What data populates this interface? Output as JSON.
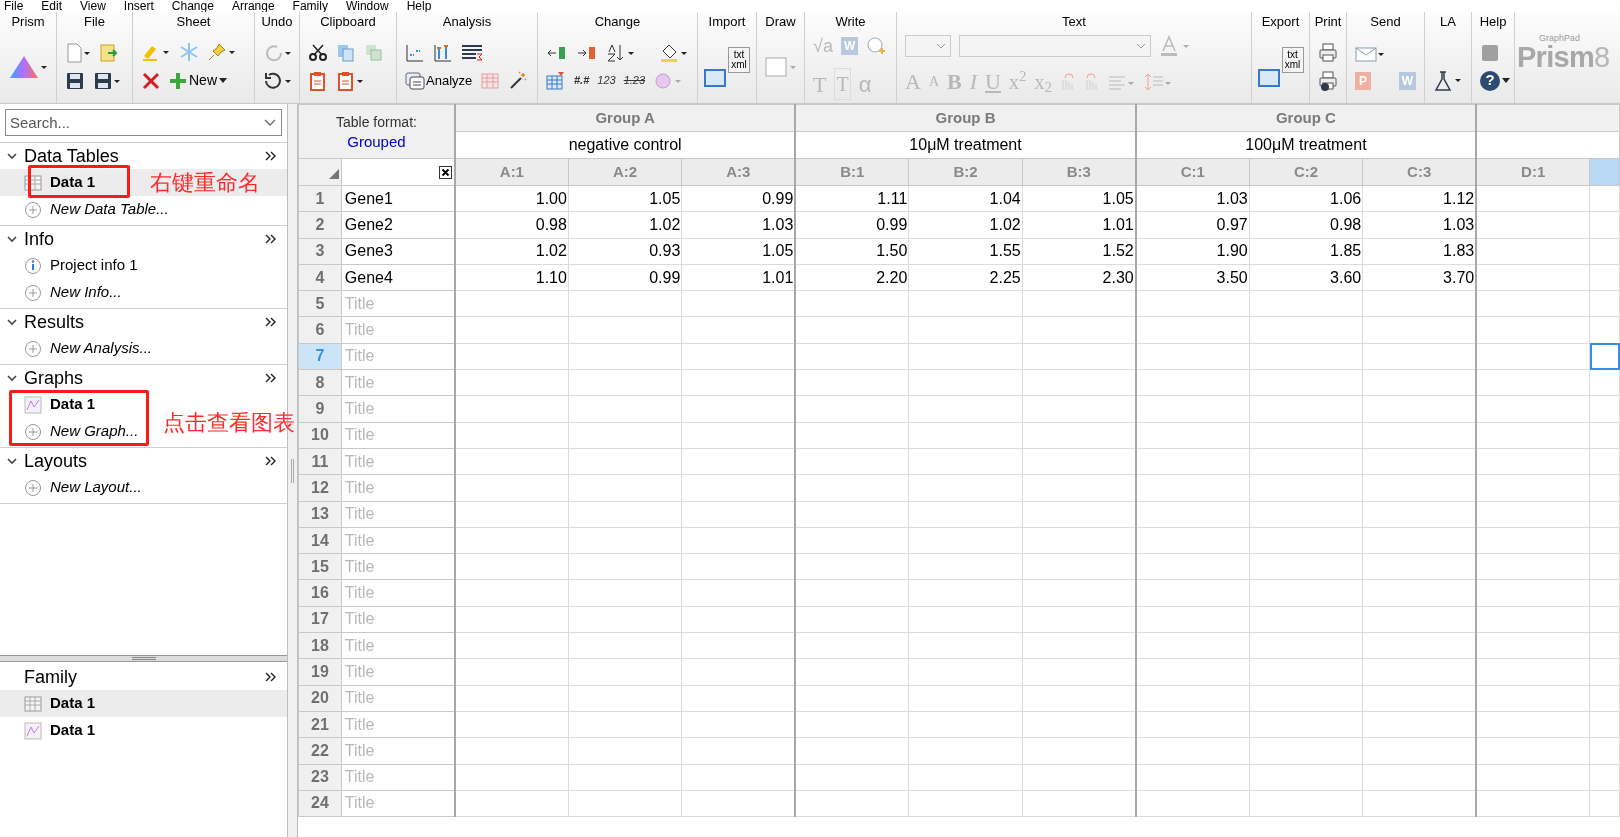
{
  "menu": [
    "File",
    "Edit",
    "View",
    "Insert",
    "Change",
    "Arrange",
    "Family",
    "Window",
    "Help"
  ],
  "toolbar": [
    {
      "kind": "prism",
      "label": "Prism"
    },
    {
      "kind": "file",
      "label": "File"
    },
    {
      "kind": "sheet",
      "label": "Sheet",
      "button": "New"
    },
    {
      "kind": "undo",
      "label": "Undo"
    },
    {
      "kind": "clipboard",
      "label": "Clipboard"
    },
    {
      "kind": "analysis",
      "label": "Analysis",
      "button": "Analyze"
    },
    {
      "kind": "change",
      "label": "Change",
      "glyphs": [
        "#.#",
        "123",
        "1.23"
      ]
    },
    {
      "kind": "import",
      "label": "Import",
      "glyphs": [
        "txt",
        "xml"
      ]
    },
    {
      "kind": "draw",
      "label": "Draw"
    },
    {
      "kind": "write",
      "label": "Write",
      "glyphs": [
        "√a",
        "W",
        "T",
        "T",
        "α"
      ]
    },
    {
      "kind": "text",
      "label": "Text",
      "glyphs": [
        "A",
        "A",
        "B",
        "I",
        "U",
        "x$^{2}$",
        "x$_{2}$"
      ]
    },
    {
      "kind": "export",
      "label": "Export",
      "glyphs": [
        "txt",
        "xml"
      ]
    },
    {
      "kind": "print",
      "label": "Print"
    },
    {
      "kind": "send",
      "label": "Send",
      "glyphs": [
        "P",
        "W"
      ]
    },
    {
      "kind": "la",
      "label": "LA"
    },
    {
      "kind": "help",
      "label": "Help",
      "glyphs": [
        "?"
      ]
    }
  ],
  "logo": {
    "brand": "GraphPad",
    "name": "Prism",
    "version": "8"
  },
  "search": {
    "placeholder": "Search..."
  },
  "sections": [
    {
      "title": "Data Tables",
      "expanded": true,
      "items": [
        {
          "kind": "table",
          "label": "Data 1",
          "selected": true
        },
        {
          "kind": "new",
          "label": "New Data Table...",
          "selected": false
        }
      ]
    },
    {
      "title": "Info",
      "expanded": true,
      "items": [
        {
          "kind": "info",
          "label": "Project info 1",
          "selected": false
        },
        {
          "kind": "new",
          "label": "New Info...",
          "selected": false
        }
      ]
    },
    {
      "title": "Results",
      "expanded": true,
      "items": [
        {
          "kind": "new",
          "label": "New Analysis...",
          "selected": false
        }
      ]
    },
    {
      "title": "Graphs",
      "expanded": true,
      "items": [
        {
          "kind": "graph",
          "label": "Data 1",
          "selected": false
        },
        {
          "kind": "new",
          "label": "New Graph...",
          "selected": false
        }
      ]
    },
    {
      "title": "Layouts",
      "expanded": true,
      "items": [
        {
          "kind": "new",
          "label": "New Layout...",
          "selected": false
        }
      ]
    }
  ],
  "family": {
    "title": "Family",
    "items": [
      {
        "kind": "table",
        "label": "Data 1",
        "selected": true
      },
      {
        "kind": "graph",
        "label": "Data 1",
        "selected": false
      }
    ]
  },
  "annotations": [
    {
      "text": "右键重命名"
    },
    {
      "text": "点击查看图表"
    }
  ],
  "table": {
    "format_label": "Table format:",
    "format": "Grouped",
    "groups": [
      {
        "name": "Group A",
        "title": "negative control",
        "columns": [
          {
            "label": "A:1",
            "selected": false
          },
          {
            "label": "A:2",
            "selected": false
          },
          {
            "label": "A:3",
            "selected": false
          }
        ]
      },
      {
        "name": "Group B",
        "title": "10μM treatment",
        "columns": [
          {
            "label": "B:1",
            "selected": false
          },
          {
            "label": "B:2",
            "selected": false
          },
          {
            "label": "B:3",
            "selected": false
          }
        ]
      },
      {
        "name": "Group C",
        "title": "100μM treatment",
        "columns": [
          {
            "label": "C:1",
            "selected": false
          },
          {
            "label": "C:2",
            "selected": false
          },
          {
            "label": "C:3",
            "selected": false
          }
        ]
      },
      {
        "columns": [
          {
            "label": "D:1",
            "selected": false
          },
          {
            "selected": true
          }
        ]
      }
    ],
    "rows": [
      {
        "number": "1",
        "title": "Gene1",
        "selected": false,
        "values": [
          "1.00",
          "1.05",
          "0.99",
          "1.11",
          "1.04",
          "1.05",
          "1.03",
          "1.06",
          "1.12"
        ]
      },
      {
        "number": "2",
        "title": "Gene2",
        "selected": false,
        "values": [
          "0.98",
          "1.02",
          "1.03",
          "0.99",
          "1.02",
          "1.01",
          "0.97",
          "0.98",
          "1.03"
        ]
      },
      {
        "number": "3",
        "title": "Gene3",
        "selected": false,
        "values": [
          "1.02",
          "0.93",
          "1.05",
          "1.50",
          "1.55",
          "1.52",
          "1.90",
          "1.85",
          "1.83"
        ]
      },
      {
        "number": "4",
        "title": "Gene4",
        "selected": false,
        "values": [
          "1.10",
          "0.99",
          "1.01",
          "2.20",
          "2.25",
          "2.30",
          "3.50",
          "3.60",
          "3.70"
        ]
      },
      {
        "number": "5",
        "placeholder": "Title",
        "selected": false
      },
      {
        "number": "6",
        "placeholder": "Title",
        "selected": false
      },
      {
        "number": "7",
        "placeholder": "Title",
        "selected": true
      },
      {
        "number": "8",
        "placeholder": "Title",
        "selected": false
      },
      {
        "number": "9",
        "placeholder": "Title",
        "selected": false
      },
      {
        "number": "10",
        "placeholder": "Title",
        "selected": false
      },
      {
        "number": "11",
        "placeholder": "Title",
        "selected": false
      },
      {
        "number": "12",
        "placeholder": "Title",
        "selected": false
      },
      {
        "number": "13",
        "placeholder": "Title",
        "selected": false
      },
      {
        "number": "14",
        "placeholder": "Title",
        "selected": false
      },
      {
        "number": "15",
        "placeholder": "Title",
        "selected": false
      },
      {
        "number": "16",
        "placeholder": "Title",
        "selected": false
      },
      {
        "number": "17",
        "placeholder": "Title",
        "selected": false
      },
      {
        "number": "18",
        "placeholder": "Title",
        "selected": false
      },
      {
        "number": "19",
        "placeholder": "Title",
        "selected": false
      },
      {
        "number": "20",
        "placeholder": "Title",
        "selected": false
      },
      {
        "number": "21",
        "placeholder": "Title",
        "selected": false
      },
      {
        "number": "22",
        "placeholder": "Title",
        "selected": false
      },
      {
        "number": "23",
        "placeholder": "Title",
        "selected": false
      },
      {
        "number": "24",
        "placeholder": "Title",
        "selected": false
      }
    ]
  }
}
